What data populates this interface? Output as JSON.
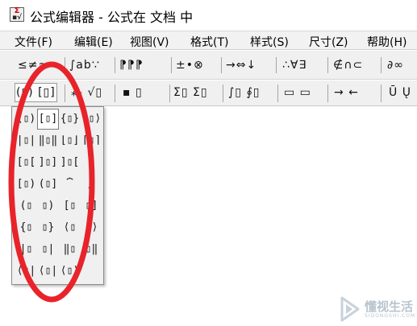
{
  "window": {
    "title": "公式编辑器 - 公式在 文档 中",
    "app_icon": "mathtype-sigma-icon"
  },
  "menubar": {
    "items": [
      {
        "label": "文件(F)"
      },
      {
        "label": "编辑(E)"
      },
      {
        "label": "视图(V)"
      },
      {
        "label": "格式(T)"
      },
      {
        "label": "样式(S)"
      },
      {
        "label": "尺寸(Z)"
      },
      {
        "label": "帮助(H)"
      }
    ]
  },
  "toolbar_top": {
    "buttons": [
      {
        "glyph": "≤≠≈"
      },
      {
        "glyph": "∫ab∵"
      },
      {
        "glyph": "⁋⁋⁋"
      },
      {
        "glyph": "±•⊗"
      },
      {
        "glyph": "→⇔↓"
      },
      {
        "glyph": "∴∀∃"
      },
      {
        "glyph": "∉∩⊂"
      },
      {
        "glyph": "∂∞"
      }
    ]
  },
  "toolbar_templates": {
    "buttons": [
      {
        "glyph": "(▯) [▯]"
      },
      {
        "glyph": "⁂ √▯"
      },
      {
        "glyph": "▪ ▯"
      },
      {
        "glyph": "Σ▯ Σ▯"
      },
      {
        "glyph": "∫▯ ∮▯"
      },
      {
        "glyph": "▭ ▭"
      },
      {
        "glyph": "→ ←"
      },
      {
        "glyph": "Ū Ų"
      }
    ]
  },
  "palette": {
    "name": "fence-templates-palette",
    "rows": [
      [
        "(▯)",
        "[▯]",
        "{▯}",
        "⟨▯⟩"
      ],
      [
        "|▯|",
        "‖▯‖",
        "⌊▯⌋",
        "⌈▯⌉"
      ],
      [
        "[▯[",
        "]▯]",
        "]▯[",
        ""
      ],
      [
        "[▯)",
        "(▯]",
        "⏞",
        "⏟"
      ],
      [
        "(▯",
        "▯)",
        "[▯",
        "▯]"
      ],
      [
        "{▯",
        "▯}",
        "⟨▯",
        "▯⟩"
      ],
      [
        "|▯",
        "▯|",
        "‖▯",
        "▯‖"
      ],
      [
        "⟨▯|",
        "⟨▯|",
        "⟨▯⟩",
        ""
      ]
    ]
  },
  "watermark": {
    "text": "懂视生活",
    "subtext": "SIDONGSHI.COM"
  },
  "colors": {
    "annotation": "#e8232a",
    "toolbar_bg": "#f0f0f0",
    "menubar_bg": "#f2f2f2"
  }
}
